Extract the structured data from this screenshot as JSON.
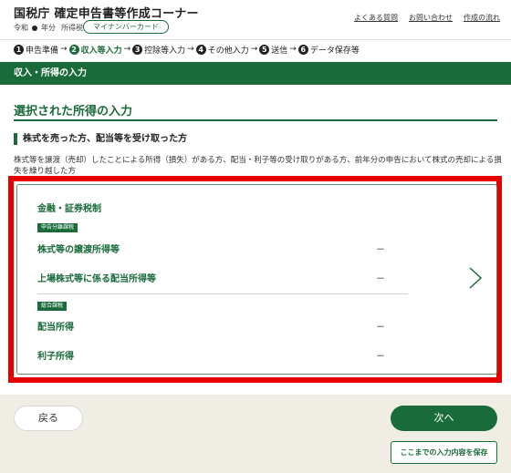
{
  "header": {
    "title": "国税庁 確定申告書等作成コーナー",
    "era": "令和",
    "year_suffix": "年分",
    "tax_type": "所得税",
    "badge": "マイナンバーカード",
    "links": [
      "よくある質問",
      "お問い合わせ",
      "作成の流れ"
    ]
  },
  "steps": [
    {
      "num": "1",
      "label": "申告準備",
      "active": false
    },
    {
      "num": "2",
      "label": "収入等入力",
      "active": true
    },
    {
      "num": "3",
      "label": "控除等入力",
      "active": false
    },
    {
      "num": "4",
      "label": "その他入力",
      "active": false
    },
    {
      "num": "5",
      "label": "送信",
      "active": false
    },
    {
      "num": "6",
      "label": "データ保存等",
      "active": false
    }
  ],
  "step_arrow": "→",
  "section_bar": "収入・所得の入力",
  "page_title": "選択された所得の入力",
  "sub_heading": "株式を売った方、配当等を受け取った方",
  "description": "株式等を譲渡（売却）したことによる所得（損失）がある方、配当・利子等の受け取りがある方、前年分の申告において株式の売却による損失を繰り越した方",
  "card": {
    "group_title": "金融・証券税制",
    "tag_separate": "申告分離課税",
    "tag_combined": "総合課税",
    "rows": [
      {
        "label": "株式等の譲渡所得等",
        "value": "－"
      },
      {
        "label": "上場株式等に係る配当所得等",
        "value": "－"
      },
      {
        "label": "配当所得",
        "value": "－"
      },
      {
        "label": "利子所得",
        "value": "－"
      }
    ]
  },
  "footer": {
    "back": "戻る",
    "next": "次へ",
    "save": "ここまでの入力内容を保存"
  },
  "colors": {
    "primary": "#1a6b3a",
    "highlight_frame": "#e60000",
    "footer_bg": "#f0eee4"
  }
}
